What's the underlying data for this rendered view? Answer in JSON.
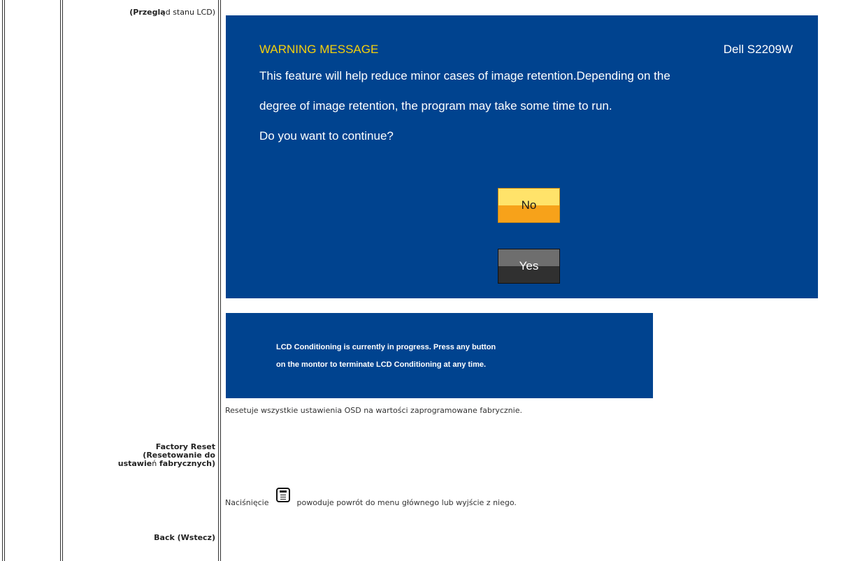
{
  "left_labels": {
    "lcd_status_bold": "(Przeglą",
    "lcd_status_rest": "d stanu LCD)",
    "factory_reset_line1": "Factory Reset",
    "factory_reset_line2": "(Resetowanie do",
    "factory_reset_line3_bold_a": "ustawie",
    "factory_reset_line3_n": "ń",
    "factory_reset_line3_rest": " fabrycznych)",
    "back": "Back (Wstecz)"
  },
  "warning_dialog": {
    "title": "WARNING MESSAGE",
    "model": "Dell S2209W",
    "line1": "This feature will help reduce minor cases of image retention.Depending on the",
    "line2": "degree of image retention, the program may take some time to run.",
    "line3": "Do you want to continue?",
    "no_label": "No",
    "yes_label": "Yes",
    "colors": {
      "background": "#00438f",
      "title": "#f5d10c",
      "no_button": "#f7a21a",
      "yes_button": "#303030"
    }
  },
  "progress_banner": {
    "line1": "LCD Conditioning is currently in progress. Press any button",
    "line2": "on the montor to terminate LCD Conditioning at any time."
  },
  "descriptions": {
    "factory_reset": "Resetuje wszystkie ustawienia OSD na wartości zaprogramowane fabrycznie.",
    "back_before": "Naciśnięcie",
    "back_icon": "menu-icon",
    "back_after": "powoduje powrót do menu głównego lub wyjście z niego."
  }
}
